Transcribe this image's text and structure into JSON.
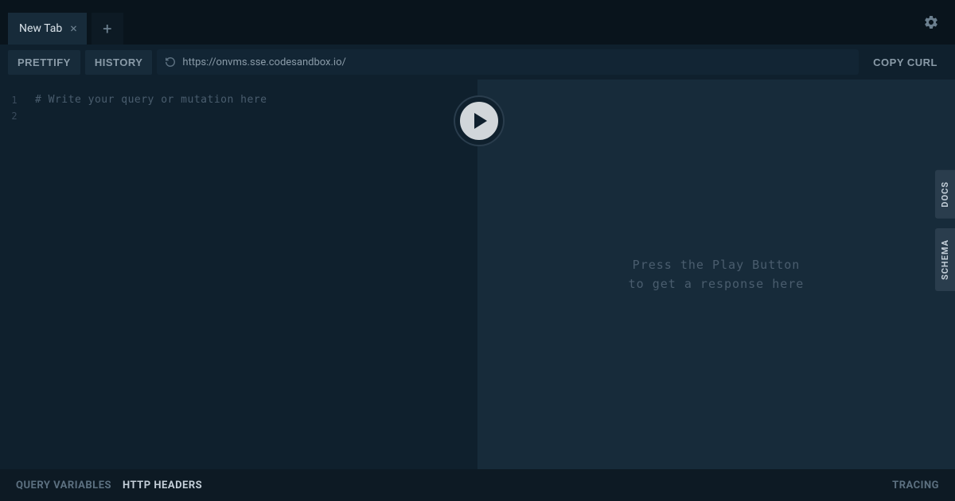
{
  "tabs": {
    "active": "New Tab"
  },
  "toolbar": {
    "prettify": "PRETTIFY",
    "history": "HISTORY",
    "copy_curl": "COPY CURL",
    "url": "https://onvms.sse.codesandbox.io/"
  },
  "editor": {
    "lines": [
      "1",
      "2"
    ],
    "placeholder_comment": "# Write your query or mutation here"
  },
  "response": {
    "placeholder_line1": "Press the Play Button",
    "placeholder_line2": "to get a response here"
  },
  "side": {
    "docs": "DOCS",
    "schema": "SCHEMA"
  },
  "bottom": {
    "query_variables": "QUERY VARIABLES",
    "http_headers": "HTTP HEADERS",
    "tracing": "TRACING"
  }
}
